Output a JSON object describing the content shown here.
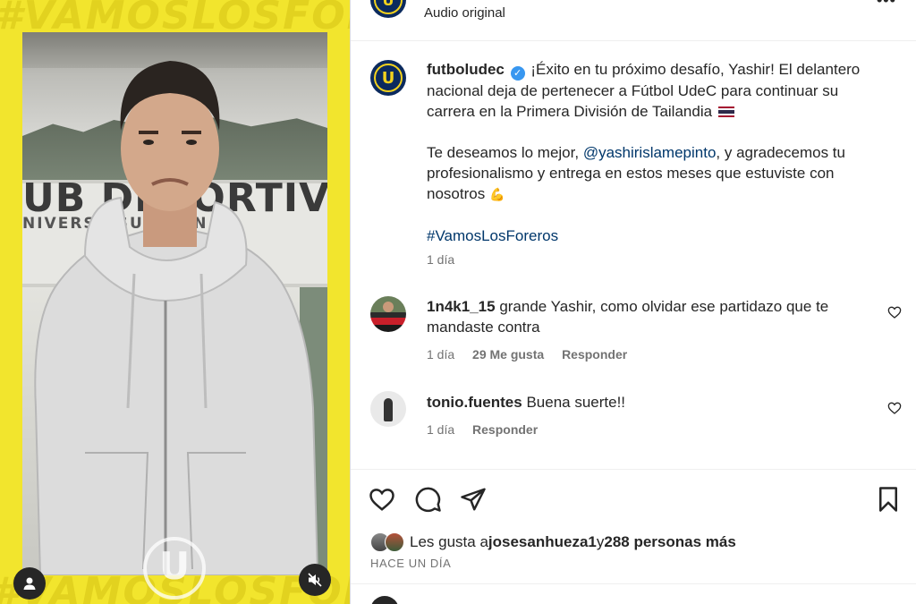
{
  "media": {
    "bg_text": "#VAMOSLOSFOREROS",
    "wall_text": "UB DEPORTIVO",
    "wall_subtext": "NIVERS   ASUNCIÓN",
    "colors": {
      "background": "#f2e52d"
    }
  },
  "header": {
    "audio_label": "Audio original",
    "more_icon": "more-icon"
  },
  "post": {
    "username": "futboludec",
    "verified": true,
    "caption_line1": "¡Éxito en tu próximo desafío, Yashir! El delantero nacional deja de pertenecer a Fútbol UdeC para continuar su carrera en la Primera División de Tailandia",
    "caption_p2_prefix": "Te deseamos lo mejor, ",
    "mention": "@yashirislamepinto",
    "caption_p2_suffix": ", y agradecemos tu profesionalismo y entrega en estos meses que estuviste con nosotros",
    "hashtag": "#VamosLosForeros",
    "time": "1 día"
  },
  "comments": [
    {
      "username": "1n4k1_15",
      "text": "grande Yashir, como olvidar ese partidazo que te mandaste contra",
      "time": "1 día",
      "likes": "29 Me gusta",
      "reply": "Responder"
    },
    {
      "username": "tonio.fuentes",
      "text": "Buena suerte!!",
      "time": "1 día",
      "reply": "Responder"
    }
  ],
  "actions": {
    "likes_prefix": "Les gusta a ",
    "liked_by": "josesanhueza1",
    "likes_middle": " y ",
    "likes_count": "288 personas más",
    "date": "HACE UN DÍA"
  },
  "theme": {
    "text": "#262626",
    "secondary": "#737373",
    "link": "#00376b",
    "verified": "#3897f0",
    "udec_blue": "#0b2a5e",
    "udec_yellow": "#f3d21d"
  }
}
